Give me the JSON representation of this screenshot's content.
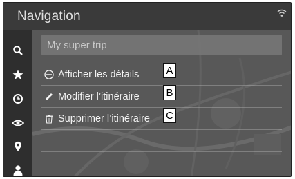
{
  "header": {
    "title": "Navigation"
  },
  "sidebar": {
    "icons": [
      "search-icon",
      "star-icon",
      "clock-icon",
      "route-eye-icon",
      "location-pin-icon",
      "person-icon"
    ]
  },
  "trip": {
    "name": "My super trip"
  },
  "menu": {
    "items": [
      {
        "label": "Afficher les détails",
        "icon": "ellipsis-circle-icon",
        "callout": "A"
      },
      {
        "label": "Modifier l’itinéraire",
        "icon": "pencil-icon",
        "callout": "B"
      },
      {
        "label": "Supprimer l’itinéraire",
        "icon": "trash-icon",
        "callout": "C"
      }
    ]
  },
  "colors": {
    "screen_bg": "#3f3f3f",
    "sidebar_bg": "#2e2e2e",
    "text": "#f2f2f2"
  }
}
